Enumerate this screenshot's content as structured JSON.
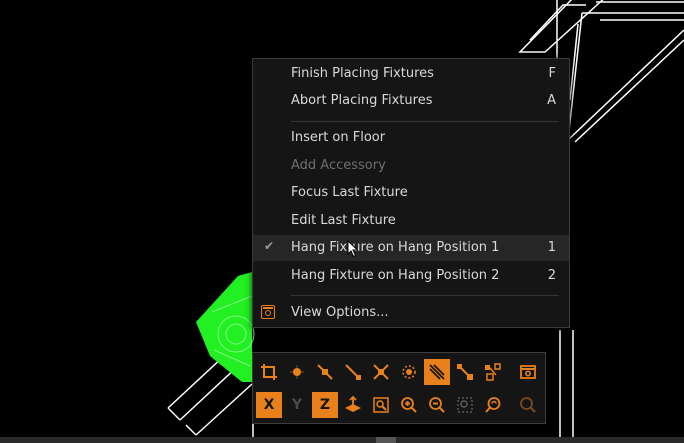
{
  "menu": {
    "items": [
      {
        "label": "Finish Placing Fixtures",
        "shortcut": "F"
      },
      {
        "label": "Abort Placing Fixtures",
        "shortcut": "A"
      },
      {
        "label": "Insert on Floor",
        "shortcut": ""
      },
      {
        "label": "Add Accessory",
        "shortcut": "",
        "disabled": true
      },
      {
        "label": "Focus Last Fixture",
        "shortcut": ""
      },
      {
        "label": "Edit Last Fixture",
        "shortcut": ""
      },
      {
        "label": "Hang Fixture on Hang Position 1",
        "shortcut": "1",
        "checked": true
      },
      {
        "label": "Hang Fixture on Hang Position 2",
        "shortcut": "2"
      },
      {
        "label": "View Options...",
        "shortcut": "",
        "icon": "view-options-icon"
      }
    ]
  },
  "toolbar": {
    "row1": [
      "crop-icon",
      "point-icon",
      "line-point-icon",
      "diagonal-line-icon",
      "cross-snap-icon",
      "dotted-circle-icon",
      "hatch-icon",
      "node-edit-icon",
      "multi-node-icon",
      "window-icon"
    ],
    "row2": {
      "x_label": "X",
      "y_label": "Y",
      "z_label": "Z",
      "icons": [
        "ground-plane-icon",
        "fit-selection-icon",
        "zoom-in-icon",
        "zoom-out-icon",
        "zoom-window-icon",
        "zoom-dynamic-icon",
        "zoom-previous-icon"
      ]
    }
  },
  "colors": {
    "accent": "#e8801c",
    "drawing_lines": "#ffffff",
    "fixture": "#22f022",
    "menu_bg": "#151515"
  }
}
